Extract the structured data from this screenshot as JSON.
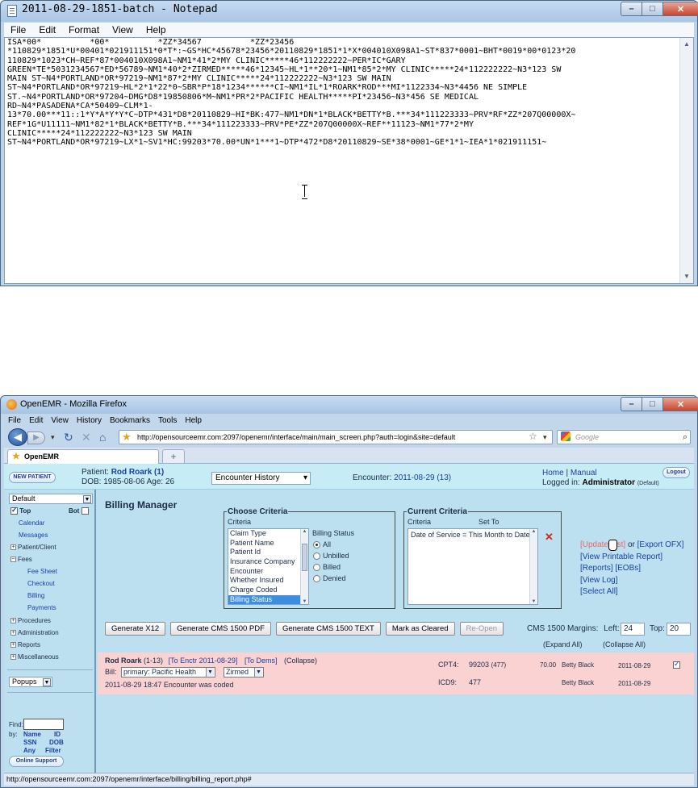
{
  "notepad": {
    "title": "2011-08-29-1851-batch - Notepad",
    "menu": [
      "File",
      "Edit",
      "Format",
      "View",
      "Help"
    ],
    "lines": [
      "ISA*00*          *00*          *ZZ*34567          *ZZ*23456",
      "*110829*1851*U*00401*021911151*0*T*:~GS*HC*45678*23456*20110829*1851*1*X*004010X098A1~ST*837*0001~BHT*0019*00*0123*20",
      "110829*1023*CH~REF*87*004010X098A1~NM1*41*2*MY CLINIC*****46*112222222~PER*IC*GARY",
      "GREEN*TE*5031234567*ED*56789~NM1*40*2*ZIRMED*****46*12345~HL*1**20*1~NM1*85*2*MY CLINIC*****24*112222222~N3*123 SW",
      "MAIN ST~N4*PORTLAND*OR*97219~NM1*87*2*MY CLINIC*****24*112222222~N3*123 SW MAIN",
      "ST~N4*PORTLAND*OR*97219~HL*2*1*22*0~SBR*P*18*1234******CI~NM1*IL*1*ROARK*ROD***MI*1122334~N3*4456 NE SIMPLE",
      "ST.~N4*PORTLAND*OR*97204~DMG*D8*19850806*M~NM1*PR*2*PACIFIC HEALTH*****PI*23456~N3*456 SE MEDICAL",
      "RD~N4*PASADENA*CA*50409~CLM*1-",
      "13*70.00***11::1*Y*A*Y*Y*C~DTP*431*D8*20110829~HI*BK:477~NM1*DN*1*BLACK*BETTY*B.***34*111223333~PRV*RF*ZZ*207Q00000X~",
      "REF*1G*U11111~NM1*82*1*BLACK*BETTY*B.***34*111223333~PRV*PE*ZZ*207Q00000X~REF**11123~NM1*77*2*MY",
      "CLINIC*****24*112222222~N3*123 SW MAIN",
      "ST~N4*PORTLAND*OR*97219~LX*1~SV1*HC:99203*70.00*UN*1***1~DTP*472*D8*20110829~SE*38*0001~GE*1*1~IEA*1*021911151~"
    ]
  },
  "firefox": {
    "title": "OpenEMR - Mozilla Firefox",
    "menu": [
      "File",
      "Edit",
      "View",
      "History",
      "Bookmarks",
      "Tools",
      "Help"
    ],
    "url": "http://opensourceemr.com:2097/openemr/interface/main/main_screen.php?auth=login&site=default",
    "search_placeholder": "Google",
    "tab_label": "OpenEMR",
    "new_tab": "+",
    "status_url": "http://opensourceemr.com:2097/openemr/interface/billing/billing_report.php#"
  },
  "header": {
    "new_patient": "NEW PATIENT",
    "patient_label": "Patient:",
    "patient_name": "Rod Roark (1)",
    "dob": "DOB: 1985-08-06 Age: 26",
    "encounter_history": "Encounter History",
    "encounter_label": "Encounter:",
    "encounter_value": "2011-08-29 (13)",
    "home": "Home",
    "sep": "|",
    "manual": "Manual",
    "logged_in": "Logged in:",
    "user": "Administrator",
    "user_suffix": "(Default)",
    "logout": "Logout"
  },
  "sidebar": {
    "layout_select": "Default",
    "top": "Top",
    "bot": "Bot",
    "calendar": "Calendar",
    "messages": "Messages",
    "patient_client": "Patient/Client",
    "fees": "Fees",
    "fee_sheet": "Fee Sheet",
    "checkout": "Checkout",
    "billing": "Billing",
    "payments": "Payments",
    "procedures": "Procedures",
    "administration": "Administration",
    "reports": "Reports",
    "miscellaneous": "Miscellaneous",
    "popups": "Popups",
    "find": "Find:",
    "by": "by:",
    "name": "Name",
    "id": "ID",
    "ssn": "SSN",
    "dob": "DOB",
    "any": "Any",
    "filter": "Filter",
    "online_support": "Online Support"
  },
  "billing": {
    "title": "Billing Manager",
    "choose_legend": "Choose Criteria",
    "criteria_header": "Criteria",
    "criteria": [
      "Claim Type",
      "Patient Name",
      "Patient Id",
      "Insurance Company",
      "Encounter",
      "Whether Insured",
      "Charge Coded",
      "Billing Status"
    ],
    "billing_status_label": "Billing Status",
    "status_options": [
      "All",
      "Unbilled",
      "Billed",
      "Denied"
    ],
    "current_legend": "Current Criteria",
    "cur_criteria_header": "Criteria",
    "cur_setto_header": "Set To",
    "current_value": "Date of Service = This Month to Date",
    "update_list": "[Update List]",
    "or": "or",
    "export_ofx": "[Export OFX]",
    "view_printable": "[View Printable Report]",
    "reports": "[Reports]",
    "eobs": "[EOBs]",
    "view_log": "[View Log]",
    "select_all": "[Select All]",
    "buttons": [
      "Generate X12",
      "Generate CMS 1500 PDF",
      "Generate CMS 1500 TEXT",
      "Mark as Cleared",
      "Re-Open"
    ],
    "margins_label": "CMS 1500 Margins:",
    "left_label": "Left:",
    "left_value": "24",
    "top_label": "Top:",
    "top_value": "20",
    "expand_all": "(Expand All)",
    "collapse_all": "(Collapse All)"
  },
  "claim": {
    "patient": "Rod Roark",
    "id": "(1-13)",
    "to_encounter": "[To Enctr 2011-08-29]",
    "to_dems": "[To Dems]",
    "collapse": "(Collapse)",
    "bill_label": "Bill:",
    "bill_select": "primary: Pacific Health",
    "partner_select": "Zirmed",
    "log": "2011-08-29 18:47 Encounter was coded",
    "rows": [
      {
        "code_type": "CPT4:",
        "code": "99203",
        "code_sub": "(477)",
        "fee": "70.00",
        "provider": "Betty Black",
        "date": "2011-08-29"
      },
      {
        "code_type": "ICD9:",
        "code": "477",
        "code_sub": "",
        "fee": "",
        "provider": "Betty Black",
        "date": "2011-08-29"
      }
    ]
  }
}
